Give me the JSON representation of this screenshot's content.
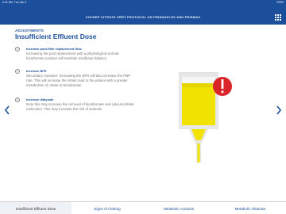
{
  "status_bar": {
    "time": "9:41 AM",
    "day": "Tue Jan 9",
    "battery": "100%"
  },
  "header": {
    "title": "COVHEP CITRATE CRRT PROTOCOL ON PRISMAFLEX AND PRISMAX",
    "menu_icon": "grid-icon"
  },
  "section": {
    "kicker": "ADJUSTMENTS",
    "title": "Insufficient Effluent Dose"
  },
  "items": [
    {
      "number": "1",
      "label": "Increase post-filter replacement flow",
      "description": "Increasing the post replacement with a physiological normal bicarbonate solution will maintain acid/base balance"
    },
    {
      "number": "2",
      "label": "Increase BFR",
      "description": "Secondary measure: Increasing the BFR will also increase the PBP rate. This will increase the citrate load to the patient with a greater metabolism of citrate to bicarbonate"
    },
    {
      "number": "3",
      "label": "Increase dialysate",
      "description": "Note this may increase the removal of bicarbonate and calcium/citrate molecules. This may increase the risk of acidosis"
    }
  ],
  "navigation": {
    "prev_icon": "chevron-left-icon",
    "next_icon": "chevron-right-icon"
  },
  "illustration": {
    "name": "effluent-bag-alert",
    "fluid_color": "#f2e200",
    "alert_color": "#d9252a"
  },
  "tabs": [
    {
      "label": "Insufficient Effluent Dose",
      "active": true
    },
    {
      "label": "Signs of Clotting",
      "active": false
    },
    {
      "label": "Metabolic Acidosis",
      "active": false
    },
    {
      "label": "Metabolic Alkalosis",
      "active": false
    }
  ],
  "colors": {
    "brand": "#1b4f9c",
    "tab_active_bg": "#eef1f5"
  }
}
